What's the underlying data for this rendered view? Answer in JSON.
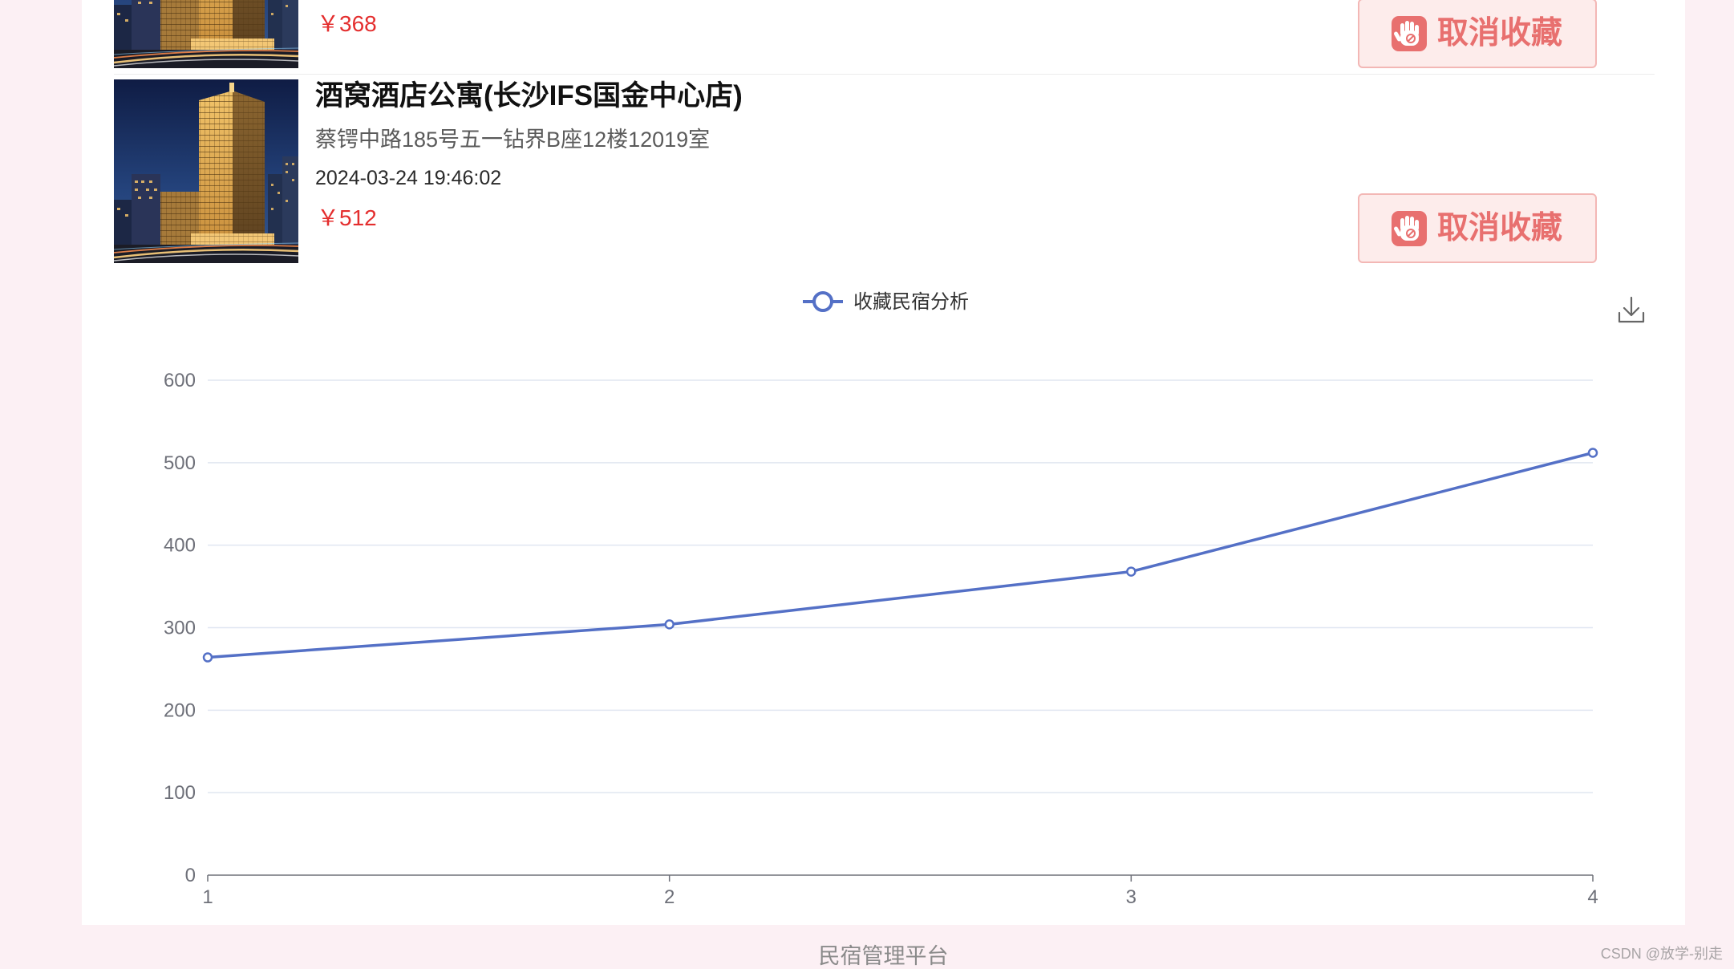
{
  "favorites": [
    {
      "price": "￥368",
      "cancel_button": {
        "icon": "hand-icon",
        "label": "取消收藏"
      }
    },
    {
      "title": "酒窝酒店公寓(长沙IFS国金中心店)",
      "address": "蔡锷中路185号五一钻界B座12楼12019室",
      "time": "2024-03-24 19:46:02",
      "price": "￥512",
      "cancel_button": {
        "icon": "hand-icon",
        "label": "取消收藏"
      }
    }
  ],
  "chart_toolbox": {
    "save_icon": "download-icon"
  },
  "chart_data": {
    "type": "line",
    "x": [
      "1",
      "2",
      "3",
      "4"
    ],
    "series": [
      {
        "name": "收藏民宿分析",
        "values": [
          264,
          304,
          368,
          512
        ],
        "color": "#5470c6"
      }
    ],
    "ylim": [
      0,
      600
    ],
    "yticks": [
      0,
      100,
      200,
      300,
      400,
      500,
      600
    ],
    "grid": true,
    "legend": "top-center",
    "colors": {
      "grid": "#e0e6f1",
      "axis": "#6e7079"
    }
  },
  "footer": {
    "text": "民宿管理平台"
  },
  "watermark": {
    "text": "CSDN @放学-别走"
  },
  "theme": {
    "page_bg": "#fcf0f4",
    "price": "#e42e2e",
    "button_text": "#e8706f",
    "button_bg": "#fdeceb"
  }
}
